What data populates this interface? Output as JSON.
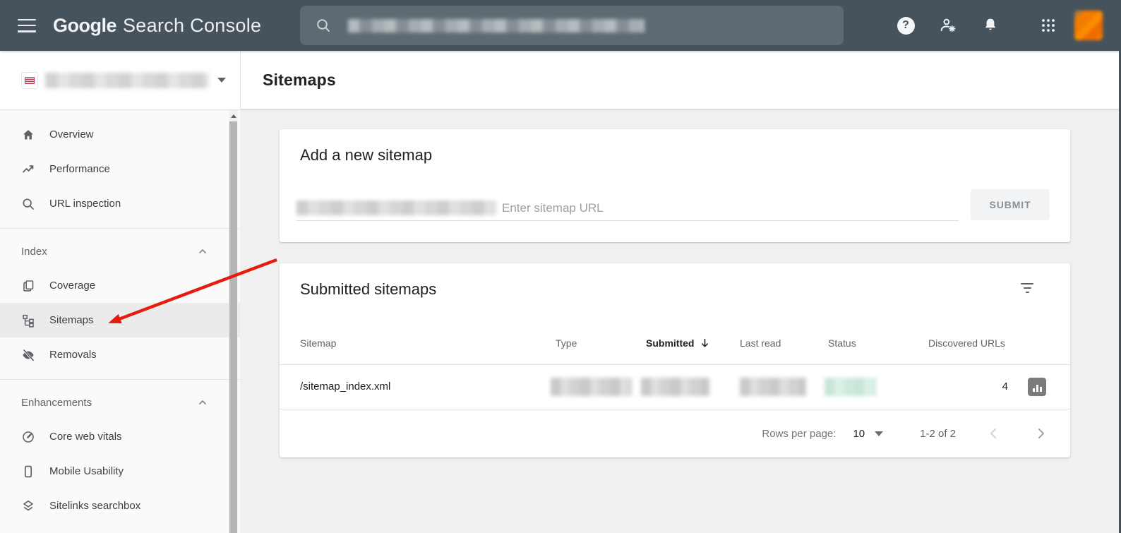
{
  "colors": {
    "header_bg": "#46535c",
    "red_arrow": "#e41d0f",
    "status_green_redacted": "#cde9dc",
    "avatar_orange": "#f57c00",
    "selected_item_bg": "#ebebeb"
  },
  "header": {
    "logo": {
      "part1": "Google",
      "part2": "Search Console"
    },
    "search": {
      "icon": "search-icon",
      "query_redacted": true
    },
    "actions": [
      {
        "icon": "help-icon"
      },
      {
        "icon": "account-settings-icon"
      },
      {
        "icon": "notifications-bell-icon"
      },
      {
        "icon": "apps-grid-icon"
      },
      {
        "icon": "avatar"
      }
    ]
  },
  "sidebar": {
    "property": {
      "icon": "site-favicon",
      "name_redacted": true,
      "chevron": "chevron-down-icon"
    },
    "primary": [
      {
        "label": "Overview",
        "icon": "home-icon"
      },
      {
        "label": "Performance",
        "icon": "performance-trend-icon"
      },
      {
        "label": "URL inspection",
        "icon": "search-icon"
      }
    ],
    "index_section": {
      "label": "Index",
      "items": [
        {
          "label": "Coverage",
          "icon": "coverage-pages-icon"
        },
        {
          "label": "Sitemaps",
          "icon": "sitemaps-tree-icon",
          "selected": true
        },
        {
          "label": "Removals",
          "icon": "visibility-off-icon"
        }
      ]
    },
    "enhancements_section": {
      "label": "Enhancements",
      "items": [
        {
          "label": "Core web vitals",
          "icon": "speedometer-icon"
        },
        {
          "label": "Mobile Usability",
          "icon": "mobile-phone-icon"
        },
        {
          "label": "Sitelinks searchbox",
          "icon": "layers-icon"
        }
      ]
    }
  },
  "page": {
    "title": "Sitemaps"
  },
  "add_card": {
    "title": "Add a new sitemap",
    "url_prefix_redacted": true,
    "input_placeholder": "Enter sitemap URL",
    "submit_label": "SUBMIT"
  },
  "sitemaps_card": {
    "title": "Submitted sitemaps",
    "columns": [
      "Sitemap",
      "Type",
      "Submitted",
      "Last read",
      "Status",
      "Discovered URLs"
    ],
    "sorted_column": "Submitted",
    "sort_direction": "descending",
    "rows": [
      {
        "sitemap": "/sitemap_index.xml",
        "type_redacted": true,
        "submitted_redacted": true,
        "last_read_redacted": true,
        "status_redacted": true,
        "discovered_urls": "4"
      }
    ],
    "pagination": {
      "rows_per_page_label": "Rows per page:",
      "rows_per_page_value": "10",
      "range_text": "1-2 of 2"
    }
  },
  "annotation": {
    "type": "red-arrow",
    "points_to": "Sitemaps sidebar item"
  }
}
